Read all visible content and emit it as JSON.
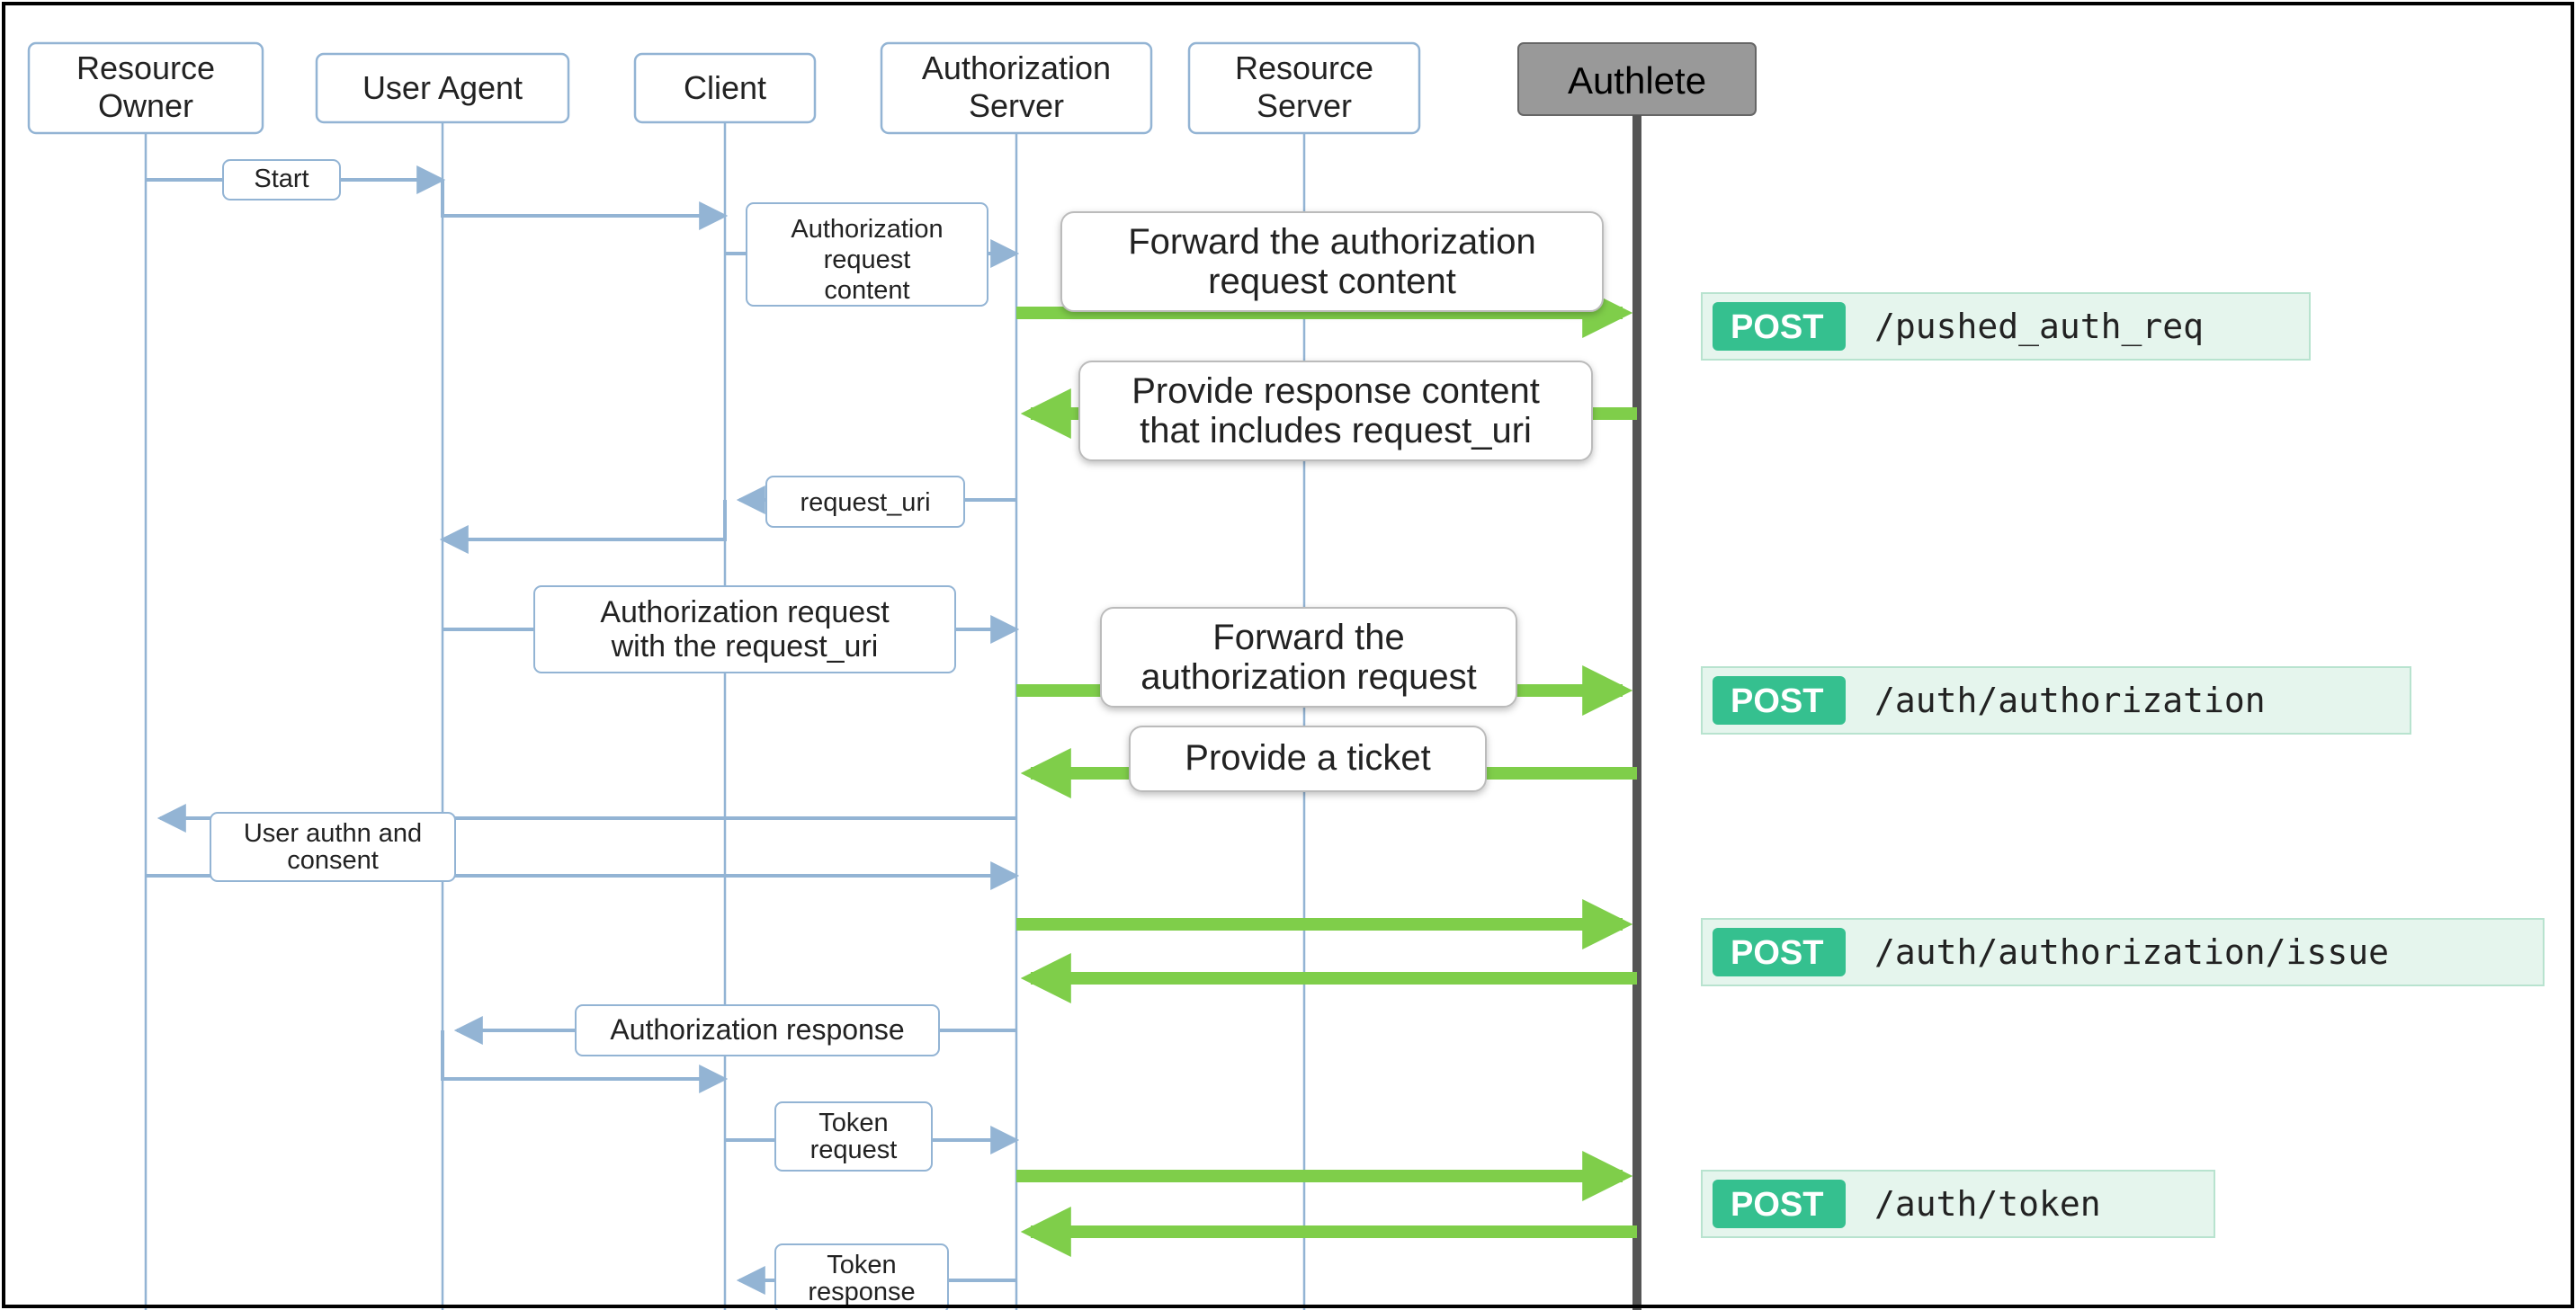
{
  "participants": [
    {
      "line1": "Resource",
      "line2": "Owner"
    },
    {
      "label": "User Agent"
    },
    {
      "label": "Client"
    },
    {
      "line1": "Authorization",
      "line2": "Server"
    },
    {
      "line1": "Resource",
      "line2": "Server"
    },
    {
      "label": "Authlete"
    }
  ],
  "messages": {
    "start": "Start",
    "auth_req_content": [
      "Authorization",
      "request",
      "content"
    ],
    "forward_auth_content": [
      "Forward the authorization",
      "request content"
    ],
    "provide_request_uri": [
      "Provide response content",
      "that includes request_uri"
    ],
    "request_uri": "request_uri",
    "auth_req_with_uri": [
      "Authorization request",
      "with the request_uri"
    ],
    "forward_auth_req": [
      "Forward the",
      "authorization request"
    ],
    "provide_ticket": "Provide a ticket",
    "user_consent": [
      "User authn and",
      "consent"
    ],
    "auth_response": "Authorization response",
    "token_req": [
      "Token",
      "request"
    ],
    "token_resp": [
      "Token",
      "response"
    ]
  },
  "api": {
    "post": "POST",
    "calls": [
      {
        "path": "/pushed_auth_req"
      },
      {
        "path": "/auth/authorization"
      },
      {
        "path": "/auth/authorization/issue"
      },
      {
        "path": "/auth/token"
      }
    ]
  },
  "chart_data": {
    "type": "sequence_diagram",
    "participants": [
      "Resource Owner",
      "User Agent",
      "Client",
      "Authorization Server",
      "Resource Server",
      "Authlete"
    ],
    "interactions": [
      {
        "from": "Resource Owner",
        "to": "User Agent",
        "label": "Start"
      },
      {
        "from": "User Agent",
        "to": "Client",
        "label": ""
      },
      {
        "from": "Client",
        "to": "Authorization Server",
        "label": "Authorization request content"
      },
      {
        "from": "Authorization Server",
        "to": "Authlete",
        "label": "Forward the authorization request content",
        "api": "POST /pushed_auth_req"
      },
      {
        "from": "Authlete",
        "to": "Authorization Server",
        "label": "Provide response content that includes request_uri"
      },
      {
        "from": "Authorization Server",
        "to": "Client",
        "label": "request_uri"
      },
      {
        "from": "Client",
        "to": "User Agent",
        "label": ""
      },
      {
        "from": "User Agent",
        "to": "Authorization Server",
        "label": "Authorization request with the request_uri"
      },
      {
        "from": "Authorization Server",
        "to": "Authlete",
        "label": "Forward the authorization request",
        "api": "POST /auth/authorization"
      },
      {
        "from": "Authlete",
        "to": "Authorization Server",
        "label": "Provide a ticket"
      },
      {
        "from": "Authorization Server",
        "to": "Resource Owner",
        "label": "User authn and consent"
      },
      {
        "from": "Resource Owner",
        "to": "Authorization Server",
        "label": "User authn and consent"
      },
      {
        "from": "Authorization Server",
        "to": "Authlete",
        "label": "",
        "api": "POST /auth/authorization/issue"
      },
      {
        "from": "Authlete",
        "to": "Authorization Server",
        "label": ""
      },
      {
        "from": "Authorization Server",
        "to": "User Agent",
        "label": "Authorization response"
      },
      {
        "from": "User Agent",
        "to": "Client",
        "label": ""
      },
      {
        "from": "Client",
        "to": "Authorization Server",
        "label": "Token request"
      },
      {
        "from": "Authorization Server",
        "to": "Authlete",
        "label": "",
        "api": "POST /auth/token"
      },
      {
        "from": "Authlete",
        "to": "Authorization Server",
        "label": ""
      },
      {
        "from": "Authorization Server",
        "to": "Client",
        "label": "Token response"
      }
    ]
  }
}
